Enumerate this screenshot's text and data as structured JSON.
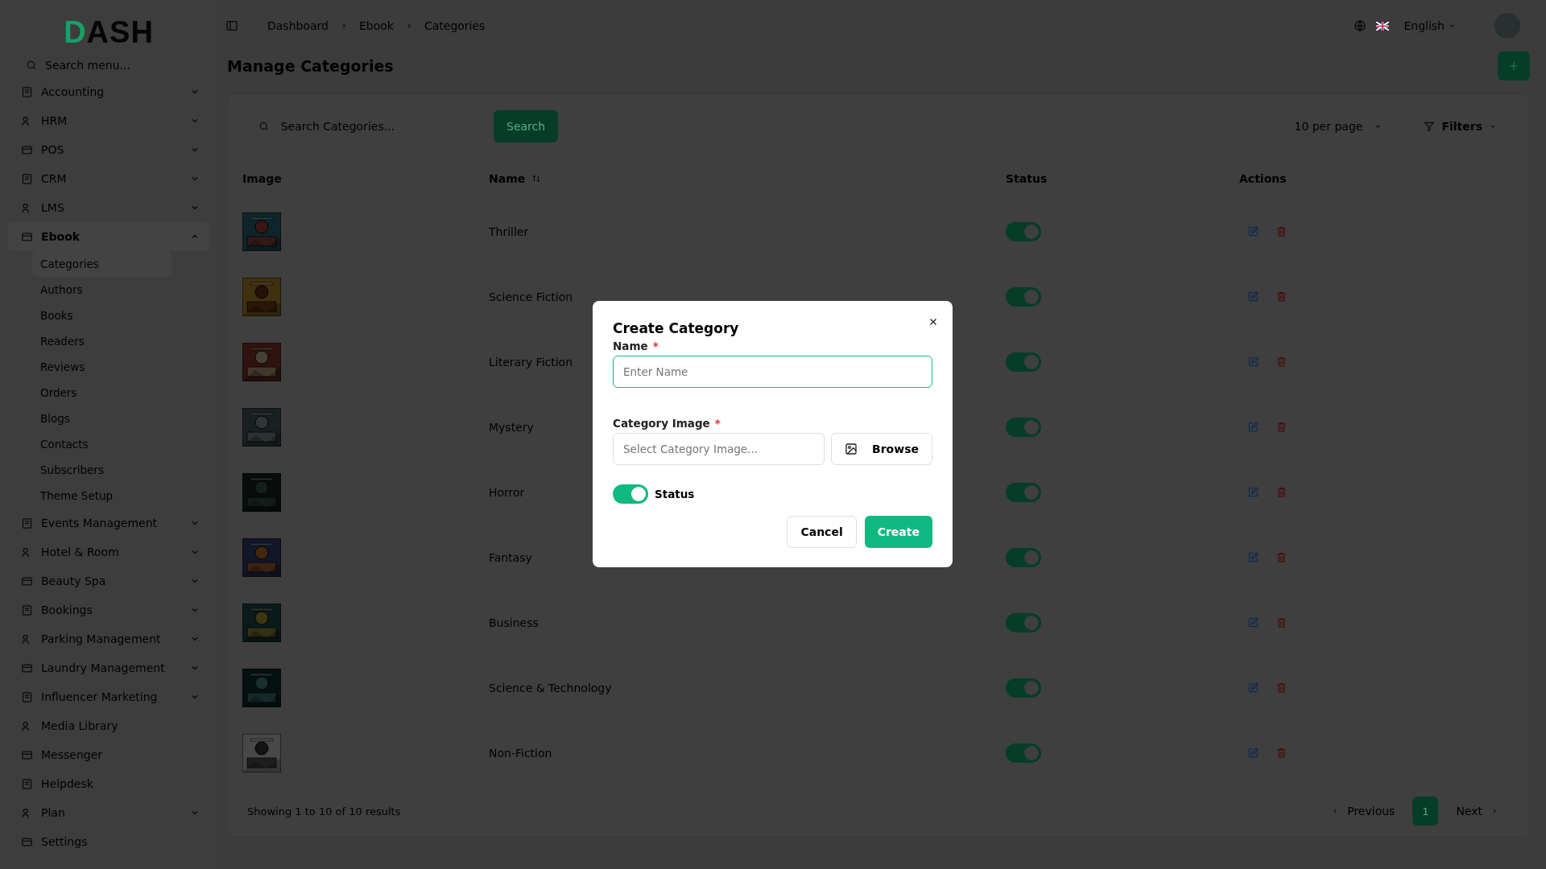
{
  "logo": "DASH",
  "sidebar": {
    "search_placeholder": "Search menu...",
    "items": [
      {
        "label": "Accounting",
        "expandable": true,
        "expanded": false,
        "selected": false
      },
      {
        "label": "HRM",
        "expandable": true,
        "expanded": false,
        "selected": false
      },
      {
        "label": "POS",
        "expandable": true,
        "expanded": false,
        "selected": false
      },
      {
        "label": "CRM",
        "expandable": true,
        "expanded": false,
        "selected": false
      },
      {
        "label": "LMS",
        "expandable": true,
        "expanded": false,
        "selected": false
      },
      {
        "label": "Ebook",
        "expandable": true,
        "expanded": true,
        "selected": true,
        "children": [
          {
            "label": "Categories",
            "selected": true
          },
          {
            "label": "Authors",
            "selected": false
          },
          {
            "label": "Books",
            "selected": false
          },
          {
            "label": "Readers",
            "selected": false
          },
          {
            "label": "Reviews",
            "selected": false
          },
          {
            "label": "Orders",
            "selected": false
          },
          {
            "label": "Blogs",
            "selected": false
          },
          {
            "label": "Contacts",
            "selected": false
          },
          {
            "label": "Subscribers",
            "selected": false
          },
          {
            "label": "Theme Setup",
            "selected": false
          }
        ]
      },
      {
        "label": "Events Management",
        "expandable": true,
        "expanded": false,
        "selected": false
      },
      {
        "label": "Hotel & Room",
        "expandable": true,
        "expanded": false,
        "selected": false
      },
      {
        "label": "Beauty Spa",
        "expandable": true,
        "expanded": false,
        "selected": false
      },
      {
        "label": "Bookings",
        "expandable": true,
        "expanded": false,
        "selected": false
      },
      {
        "label": "Parking Management",
        "expandable": true,
        "expanded": false,
        "selected": false
      },
      {
        "label": "Laundry Management",
        "expandable": true,
        "expanded": false,
        "selected": false
      },
      {
        "label": "Influencer Marketing",
        "expandable": true,
        "expanded": false,
        "selected": false
      },
      {
        "label": "Media Library",
        "expandable": false,
        "expanded": false,
        "selected": false
      },
      {
        "label": "Messenger",
        "expandable": false,
        "expanded": false,
        "selected": false
      },
      {
        "label": "Helpdesk",
        "expandable": false,
        "expanded": false,
        "selected": false
      },
      {
        "label": "Plan",
        "expandable": true,
        "expanded": false,
        "selected": false
      },
      {
        "label": "Settings",
        "expandable": false,
        "expanded": false,
        "selected": false
      }
    ]
  },
  "breadcrumb": [
    "Dashboard",
    "Ebook",
    "Categories"
  ],
  "language": "English",
  "page_title": "Manage Categories",
  "search": {
    "placeholder": "Search Categories...",
    "button": "Search"
  },
  "per_page": "10 per page",
  "filters": "Filters",
  "table": {
    "columns": [
      "Image",
      "Name",
      "Status",
      "Actions"
    ],
    "rows": [
      {
        "name": "Thriller",
        "active": true
      },
      {
        "name": "Science Fiction",
        "active": true
      },
      {
        "name": "Literary Fiction",
        "active": true
      },
      {
        "name": "Mystery",
        "active": true
      },
      {
        "name": "Horror",
        "active": true
      },
      {
        "name": "Fantasy",
        "active": true
      },
      {
        "name": "Business",
        "active": true
      },
      {
        "name": "Science & Technology",
        "active": true
      },
      {
        "name": "Non-Fiction",
        "active": true
      }
    ]
  },
  "footer": {
    "summary": "Showing 1 to 10 of 10 results",
    "previous": "Previous",
    "pages": [
      {
        "label": "1",
        "selected": true
      }
    ],
    "next": "Next"
  },
  "modal": {
    "title": "Create Category",
    "name_label": "Name",
    "name_placeholder": "Enter Name",
    "required_mark": "*",
    "image_label": "Category Image",
    "image_placeholder": "Select Category Image...",
    "browse": "Browse",
    "status_label": "Status",
    "status_on": true,
    "cancel": "Cancel",
    "create": "Create"
  }
}
